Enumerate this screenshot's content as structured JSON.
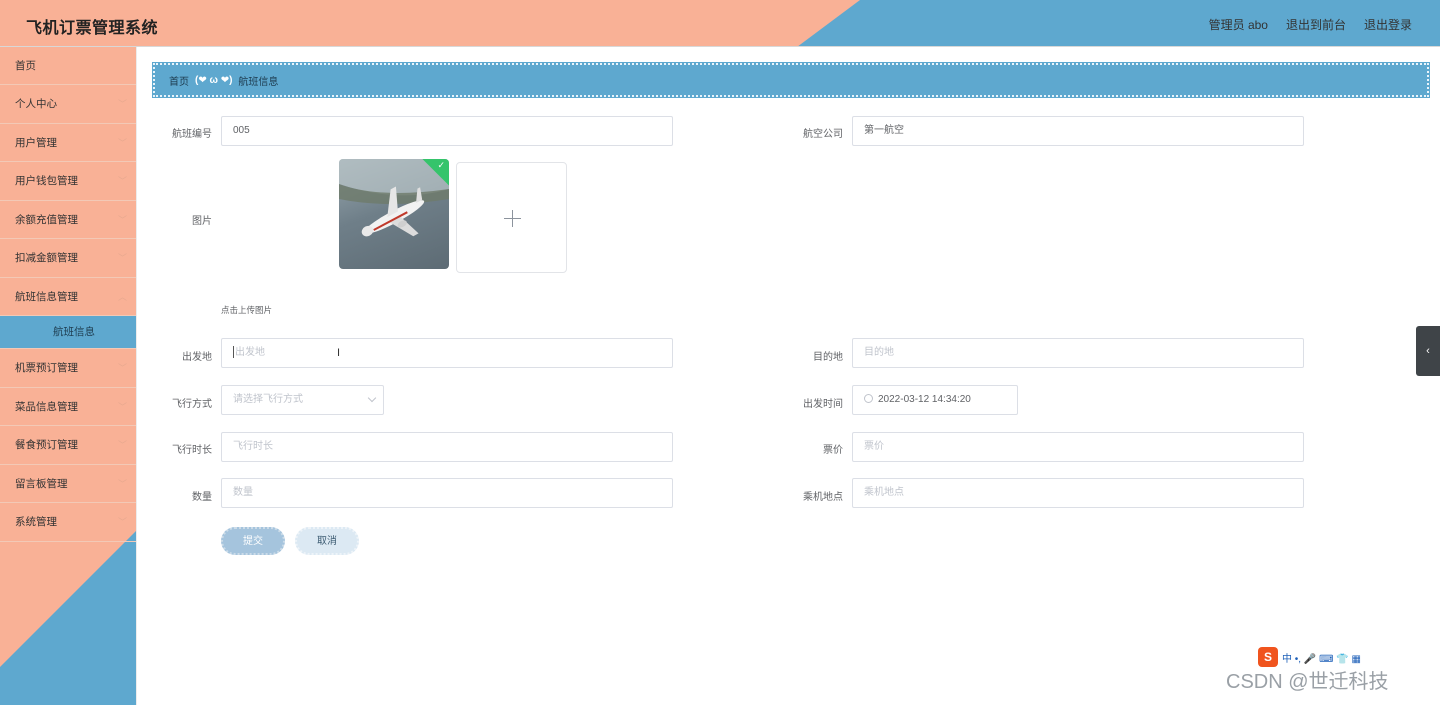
{
  "header": {
    "title": "飞机订票管理系统",
    "nav": [
      "管理员 abo",
      "退出到前台",
      "退出登录"
    ]
  },
  "sidebar": {
    "items": [
      {
        "label": "首页",
        "has_children": false
      },
      {
        "label": "个人中心",
        "has_children": true
      },
      {
        "label": "用户管理",
        "has_children": true
      },
      {
        "label": "用户钱包管理",
        "has_children": true
      },
      {
        "label": "余额充值管理",
        "has_children": true
      },
      {
        "label": "扣减金额管理",
        "has_children": true
      },
      {
        "label": "航班信息管理",
        "has_children": true,
        "open": true,
        "children": [
          "航班信息"
        ]
      },
      {
        "label": "机票预订管理",
        "has_children": true
      },
      {
        "label": "菜品信息管理",
        "has_children": true
      },
      {
        "label": "餐食预订管理",
        "has_children": true
      },
      {
        "label": "留言板管理",
        "has_children": true
      },
      {
        "label": "系统管理",
        "has_children": true
      }
    ]
  },
  "breadcrumb": {
    "home": "首页",
    "separator": "(❤ ω ❤)",
    "current": "航班信息"
  },
  "form": {
    "flight_no": {
      "label": "航班编号",
      "value": "005"
    },
    "airline": {
      "label": "航空公司",
      "value": "第一航空"
    },
    "image": {
      "label": "图片",
      "tip": "点击上传图片",
      "upload_icon": "plus-icon"
    },
    "departure": {
      "label": "出发地",
      "placeholder": "出发地"
    },
    "destination": {
      "label": "目的地",
      "placeholder": "目的地"
    },
    "flight_mode": {
      "label": "飞行方式",
      "placeholder": "请选择飞行方式"
    },
    "depart_time": {
      "label": "出发时间",
      "value": "2022-03-12 14:34:20"
    },
    "duration": {
      "label": "飞行时长",
      "placeholder": "飞行时长"
    },
    "price": {
      "label": "票价",
      "placeholder": "票价"
    },
    "quantity": {
      "label": "数量",
      "placeholder": "数量"
    },
    "boarding": {
      "label": "乘机地点",
      "placeholder": "乘机地点"
    },
    "submit_label": "提交",
    "cancel_label": "取消"
  },
  "overlay": {
    "ime": {
      "logo": "S",
      "text": "中 •, 🎤 ⌨ 👕 ▦"
    },
    "watermark": "CSDN @世迁科技"
  },
  "colors": {
    "salmon": "#f9b196",
    "blue": "#5ea8cf",
    "success": "#35c46b"
  }
}
